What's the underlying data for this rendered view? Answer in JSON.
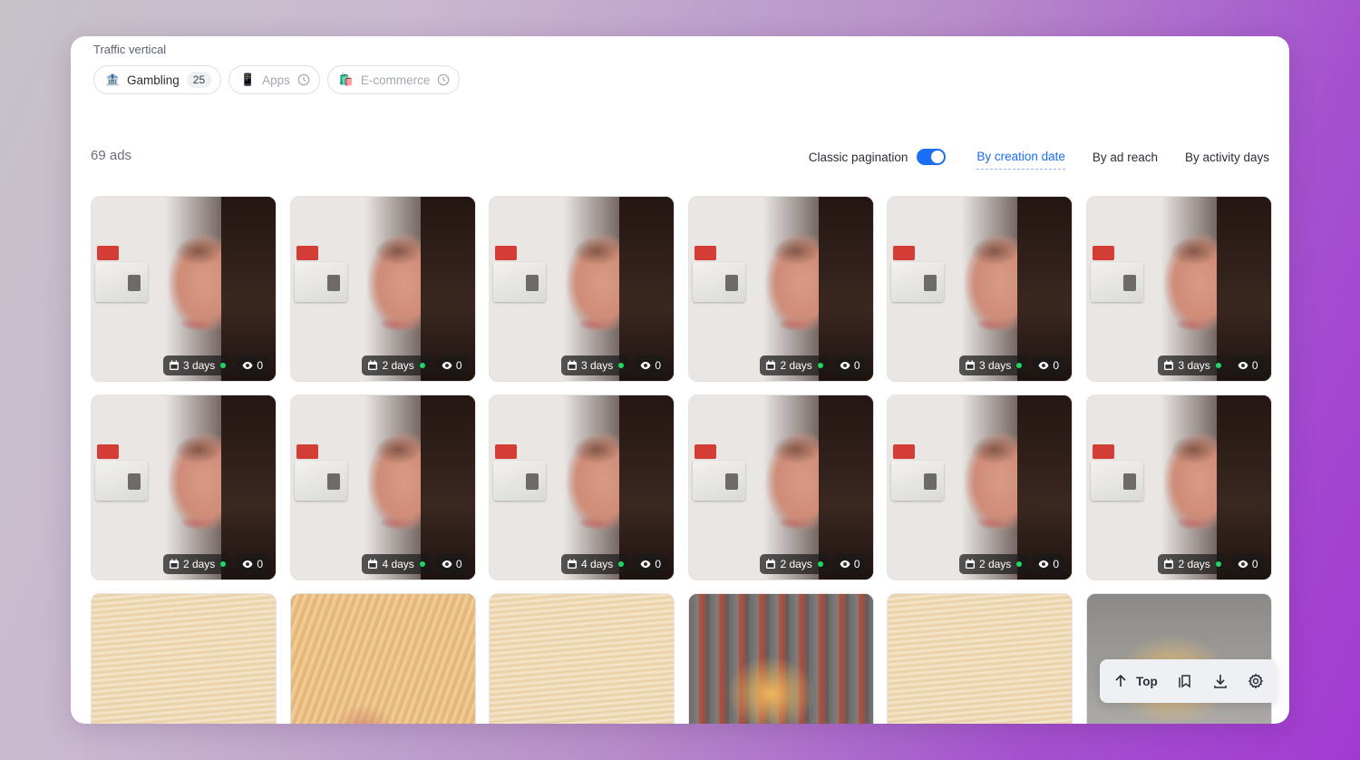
{
  "filters": {
    "section_label": "Traffic vertical",
    "chips": [
      {
        "emoji": "🏦",
        "label": "Gambling",
        "count": "25",
        "muted": false
      },
      {
        "emoji": "📱",
        "label": "Apps",
        "muted": true
      },
      {
        "emoji": "🛍️",
        "label": "E-commerce",
        "muted": true
      }
    ]
  },
  "toolbar": {
    "ads_count": "69 ads",
    "pagination_label": "Classic pagination",
    "pagination_enabled": true,
    "sort_tabs": [
      "By creation date",
      "By ad reach",
      "By activity days"
    ],
    "active_sort": "By creation date"
  },
  "cards": [
    {
      "kind": "face",
      "days": "3 days",
      "views": "0"
    },
    {
      "kind": "face",
      "days": "2 days",
      "views": "0"
    },
    {
      "kind": "face",
      "days": "3 days",
      "views": "0"
    },
    {
      "kind": "face",
      "days": "2 days",
      "views": "0"
    },
    {
      "kind": "face",
      "days": "3 days",
      "views": "0"
    },
    {
      "kind": "face",
      "days": "3 days",
      "views": "0"
    },
    {
      "kind": "face",
      "days": "2 days",
      "views": "0"
    },
    {
      "kind": "face",
      "days": "4 days",
      "views": "0"
    },
    {
      "kind": "face",
      "days": "4 days",
      "views": "0"
    },
    {
      "kind": "face",
      "days": "2 days",
      "views": "0"
    },
    {
      "kind": "face",
      "days": "2 days",
      "views": "0"
    },
    {
      "kind": "face",
      "days": "2 days",
      "views": "0"
    },
    {
      "kind": "money"
    },
    {
      "kind": "money-dark"
    },
    {
      "kind": "money"
    },
    {
      "kind": "money-shop"
    },
    {
      "kind": "money"
    },
    {
      "kind": "money-shop2"
    }
  ],
  "floating_bar": {
    "top_label": "Top"
  },
  "colors": {
    "accent": "#1a6ef5",
    "active_dot": "#1ed760"
  }
}
